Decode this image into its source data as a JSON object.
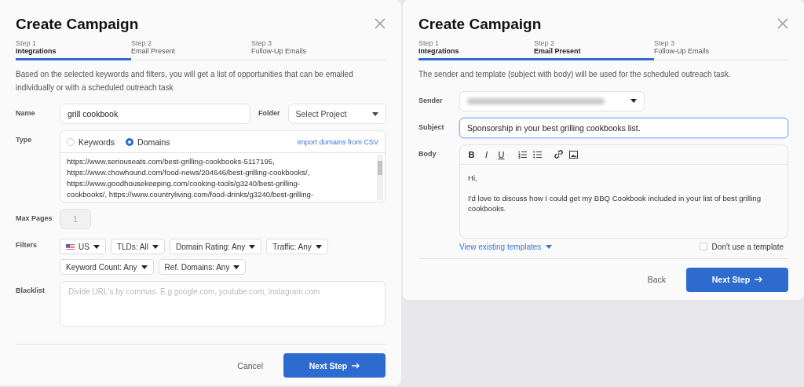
{
  "dialogs": [
    {
      "kind": "integrations",
      "title": "Create Campaign",
      "steps": [
        {
          "number": "Step 1",
          "label": "Integrations",
          "done": true
        },
        {
          "number": "Step 2",
          "label": "Email Present",
          "done": false
        },
        {
          "number": "Step 3",
          "label": "Follow-Up Emails",
          "done": false
        }
      ],
      "description": "Based on the selected keywords and filters, you will get a list of opportunities that can be emailed individually or with a scheduled outreach task",
      "name": {
        "label": "Name",
        "value": "grill cookbook"
      },
      "folder": {
        "label": "Folder",
        "value": "Select Project"
      },
      "type": {
        "label": "Type",
        "options": [
          {
            "label": "Keywords",
            "selected": false
          },
          {
            "label": "Domains",
            "selected": true
          }
        ],
        "import_link": "Import domains from CSV",
        "lines": [
          "https://www.seriouseats.com/best-grilling-cookbooks-5117195,",
          "https://www.chowhound.com/food-news/204646/best-grilling-cookbooks/,",
          "https://www.goodhousekeeping.com/cooking-tools/g3240/best-grilling-",
          "cookbooks/, https://www.countryliving.com/food-drinks/g3240/best-grilling-"
        ]
      },
      "max_pages": {
        "label": "Max Pages",
        "placeholder": "1",
        "disabled": true
      },
      "filters": {
        "label": "Filters",
        "items": [
          {
            "kind": "flag",
            "label": "US"
          },
          {
            "kind": "plain",
            "label": "TLDs: All"
          },
          {
            "kind": "plain",
            "label": "Domain Rating: Any"
          },
          {
            "kind": "plain",
            "label": "Traffic: Any"
          },
          {
            "kind": "plain",
            "label": "Keyword Count: Any"
          },
          {
            "kind": "plain",
            "label": "Ref. Domains: Any"
          }
        ]
      },
      "blacklist": {
        "label": "Blacklist",
        "placeholder": "Divide URL's by commas. E.g google.com, youtube.com, instagram.com"
      },
      "buttons": {
        "secondary": "Cancel",
        "primary": "Next Step"
      }
    },
    {
      "kind": "email",
      "title": "Create Campaign",
      "steps": [
        {
          "number": "Step 1",
          "label": "Integrations",
          "done": true
        },
        {
          "number": "Step 2",
          "label": "Email Present",
          "done": true
        },
        {
          "number": "Step 3",
          "label": "Follow-Up Emails",
          "done": false
        }
      ],
      "description": "The sender and template (subject with body) will be used for the scheduled outreach task.",
      "sender": {
        "label": "Sender",
        "blurred": true
      },
      "subject": {
        "label": "Subject",
        "value": "Sponsorship in your best grilling cookbooks list.",
        "focused": true
      },
      "body": {
        "label": "Body",
        "toolbar": [
          {
            "kind": "bold",
            "label": "B"
          },
          {
            "kind": "italic",
            "label": "I"
          },
          {
            "kind": "underline",
            "label": "U"
          },
          {
            "kind": "numbered-list"
          },
          {
            "kind": "bullet-list"
          },
          {
            "kind": "link"
          },
          {
            "kind": "image"
          }
        ],
        "paragraphs": [
          "Hi,",
          "I'd love to discuss how I could get my BBQ Cookbook included in your list of best grilling cookbooks."
        ]
      },
      "templates_link": "View existing templates",
      "no_template": {
        "label": "Don't use a template",
        "checked": false
      },
      "buttons": {
        "secondary": "Back",
        "primary": "Next Step"
      }
    }
  ]
}
